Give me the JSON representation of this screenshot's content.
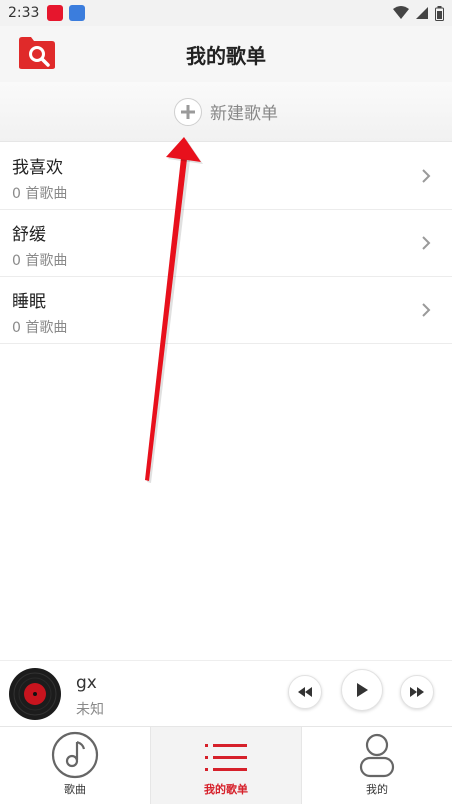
{
  "status_bar": {
    "time": "2:33"
  },
  "header": {
    "title": "我的歌单",
    "logo_icon": "folder-search-icon",
    "accent": "#e02a2a"
  },
  "new_playlist": {
    "label": "新建歌单",
    "icon": "plus-icon"
  },
  "playlists": [
    {
      "name": "我喜欢",
      "count": "0 首歌曲"
    },
    {
      "name": "舒缓",
      "count": "0 首歌曲"
    },
    {
      "name": "睡眠",
      "count": "0 首歌曲"
    }
  ],
  "player": {
    "title": "gx",
    "artist": "未知"
  },
  "nav": {
    "tabs": [
      {
        "label": "歌曲",
        "icon": "music-note-icon"
      },
      {
        "label": "我的歌单",
        "icon": "list-icon"
      },
      {
        "label": "我的",
        "icon": "person-icon"
      }
    ],
    "active_index": 1,
    "active_color": "#d6202a"
  }
}
